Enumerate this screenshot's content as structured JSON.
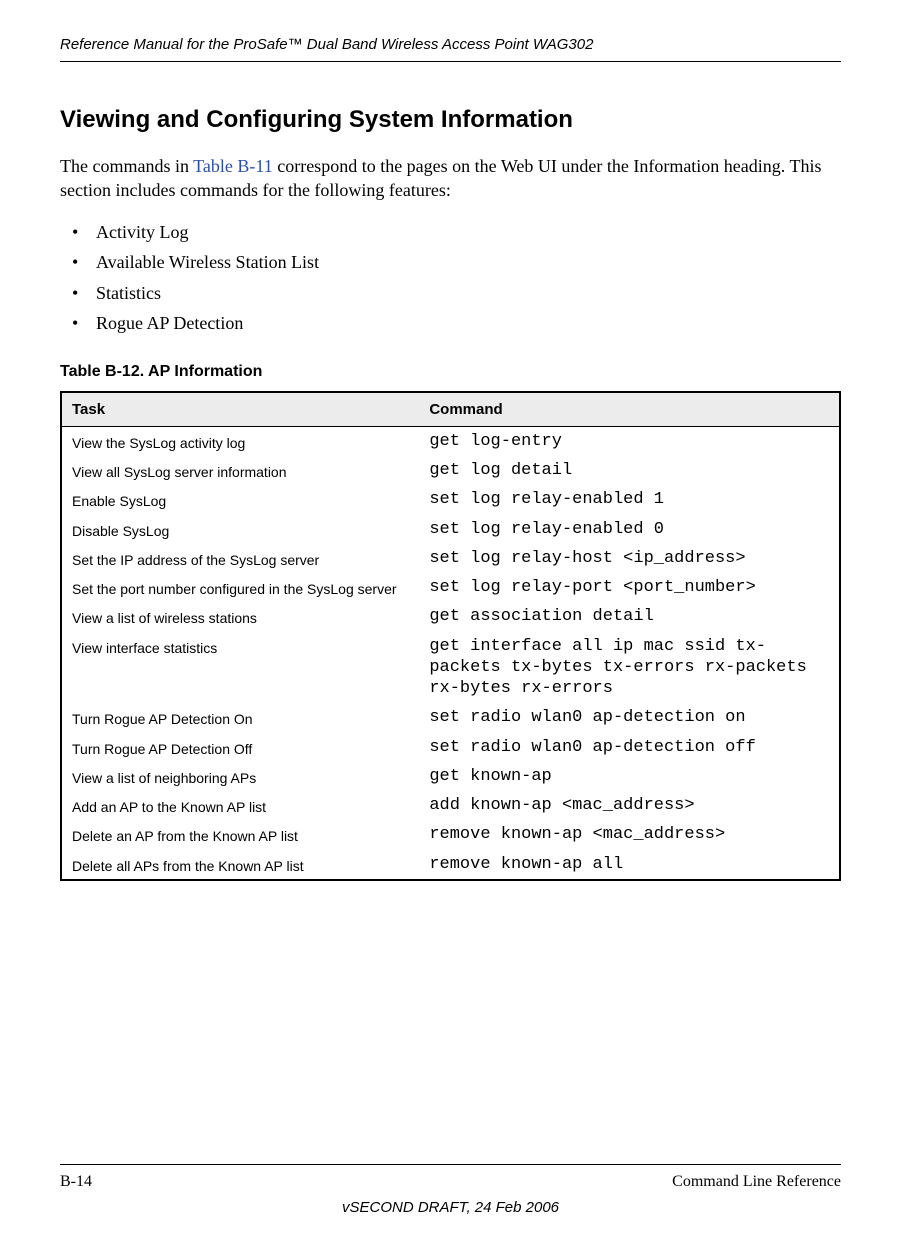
{
  "header": {
    "running_title": "Reference Manual for the ProSafe™ Dual Band Wireless Access Point WAG302"
  },
  "section": {
    "heading": "Viewing and Configuring System Information",
    "intro_pre": "The commands in ",
    "intro_link": "Table B-11",
    "intro_post": " correspond to the pages on the Web UI under the Information heading. This section includes commands for the following features:",
    "features": [
      "Activity Log",
      "Available Wireless Station List",
      "Statistics",
      "Rogue AP Detection"
    ]
  },
  "table": {
    "caption": "Table B-12. AP Information",
    "headers": {
      "task": "Task",
      "command": "Command"
    },
    "rows": [
      {
        "task": "View the SysLog activity log",
        "command": "get log-entry"
      },
      {
        "task": "View all SysLog server information",
        "command": "get log detail"
      },
      {
        "task": "Enable SysLog",
        "command": "set log relay-enabled 1"
      },
      {
        "task": "Disable SysLog",
        "command": "set log relay-enabled 0"
      },
      {
        "task": "Set the IP address of the SysLog server",
        "command": "set log relay-host <ip_address>"
      },
      {
        "task": "Set the port number configured in the SysLog server",
        "command": "set log relay-port <port_number>"
      },
      {
        "task": "View a list of wireless stations",
        "command": "get association detail"
      },
      {
        "task": "View interface statistics",
        "command": "get interface all ip mac ssid tx-packets tx-bytes tx-errors rx-packets rx-bytes rx-errors"
      },
      {
        "task": "Turn Rogue AP Detection On",
        "command": "set radio wlan0 ap-detection on"
      },
      {
        "task": "Turn Rogue AP Detection Off",
        "command": "set radio wlan0 ap-detection off"
      },
      {
        "task": "View a list of neighboring APs",
        "command": "get known-ap"
      },
      {
        "task": "Add an AP to the Known AP list",
        "command": "add known-ap <mac_address>"
      },
      {
        "task": "Delete an AP from the Known AP list",
        "command": "remove known-ap <mac_address>"
      },
      {
        "task": "Delete all APs from the Known AP list",
        "command": "remove known-ap all"
      }
    ]
  },
  "footer": {
    "page": "B-14",
    "right": "Command Line Reference",
    "center": "vSECOND DRAFT, 24 Feb 2006"
  }
}
